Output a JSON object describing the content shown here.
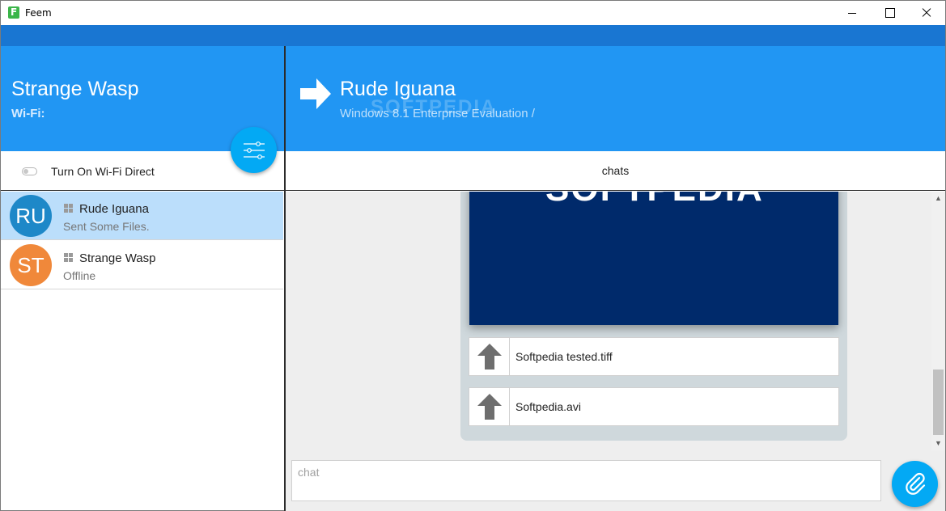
{
  "window": {
    "title": "Feem",
    "controls": {
      "minimize": "minimize-icon",
      "maximize": "maximize-icon",
      "close": "close-icon"
    }
  },
  "colors": {
    "accent": "#2196f3",
    "accent_dark": "#1976d2",
    "fab": "#03a9f4",
    "selected_row": "#bbdefb",
    "avatar_ru": "#1e88c8",
    "avatar_st": "#f0883a"
  },
  "sidebar": {
    "self_name": "Strange Wasp",
    "wifi_label": "Wi-Fi:",
    "settings_icon": "sliders-icon",
    "wifi_direct": {
      "label": "Turn On Wi-Fi Direct",
      "enabled": false
    },
    "devices": [
      {
        "initials": "RU",
        "name": "Rude Iguana",
        "status": "Sent Some Files.",
        "os_icon": "windows-icon",
        "selected": true
      },
      {
        "initials": "ST",
        "name": "Strange Wasp",
        "status": "Offline",
        "os_icon": "windows-icon",
        "selected": false
      }
    ]
  },
  "conversation": {
    "peer_name": "Rude Iguana",
    "peer_os": "Windows 8.1 Enterprise Evaluation /",
    "watermark": "SOFTPEDIA",
    "tab": "chats",
    "image_text": "SOFTPEDIA",
    "files": [
      {
        "name": "Softpedia tested.tiff",
        "icon": "upload-arrow-icon"
      },
      {
        "name": "Softpedia.avi",
        "icon": "upload-arrow-icon"
      }
    ]
  },
  "composer": {
    "placeholder": "chat",
    "value": "",
    "attach_icon": "paperclip-icon"
  }
}
